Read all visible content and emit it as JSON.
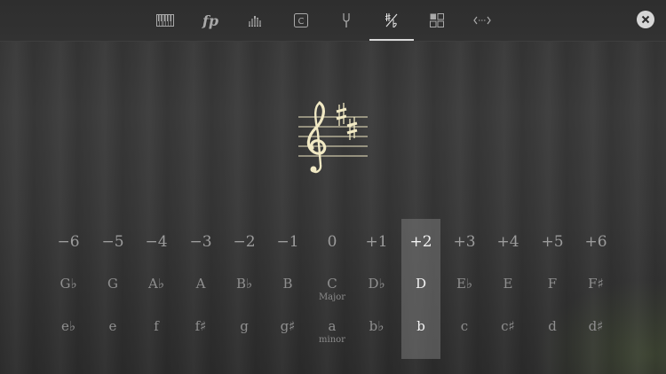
{
  "toolbar": {
    "tabs": [
      {
        "name": "keyboard",
        "icon": "piano-keys-icon"
      },
      {
        "name": "dynamics",
        "label": "fp",
        "icon": "dynamics-icon"
      },
      {
        "name": "mixer",
        "icon": "level-bars-icon"
      },
      {
        "name": "key",
        "label": "C",
        "icon": "key-c-icon"
      },
      {
        "name": "tuning",
        "icon": "tuning-fork-icon"
      },
      {
        "name": "key-signature",
        "icon": "sharp-flat-icon",
        "active": true
      },
      {
        "name": "layout",
        "icon": "grid-squares-icon"
      },
      {
        "name": "range",
        "icon": "range-arrows-icon"
      }
    ],
    "close_icon": "close-icon"
  },
  "staff": {
    "clef": "treble-clef-icon",
    "accidentals": "2 sharps"
  },
  "transpose": {
    "selected_index": 8,
    "shifts": [
      "−6",
      "−5",
      "−4",
      "−3",
      "−2",
      "−1",
      "0",
      "+1",
      "+2",
      "+3",
      "+4",
      "+5",
      "+6"
    ],
    "major_keys": [
      "G♭",
      "G",
      "A♭",
      "A",
      "B♭",
      "B",
      "C",
      "D♭",
      "D",
      "E♭",
      "E",
      "F",
      "F♯"
    ],
    "minor_keys": [
      "e♭",
      "e",
      "f",
      "f♯",
      "g",
      "g♯",
      "a",
      "b♭",
      "b",
      "c",
      "c♯",
      "d",
      "d♯"
    ],
    "major_caption": "Major",
    "minor_caption": "minor"
  },
  "colors": {
    "background": "#363636",
    "selected_column": "#6e6e6e",
    "text": "#9c9c9c",
    "selected_text": "#f2f2f2",
    "staff": "#f1e9c4"
  }
}
